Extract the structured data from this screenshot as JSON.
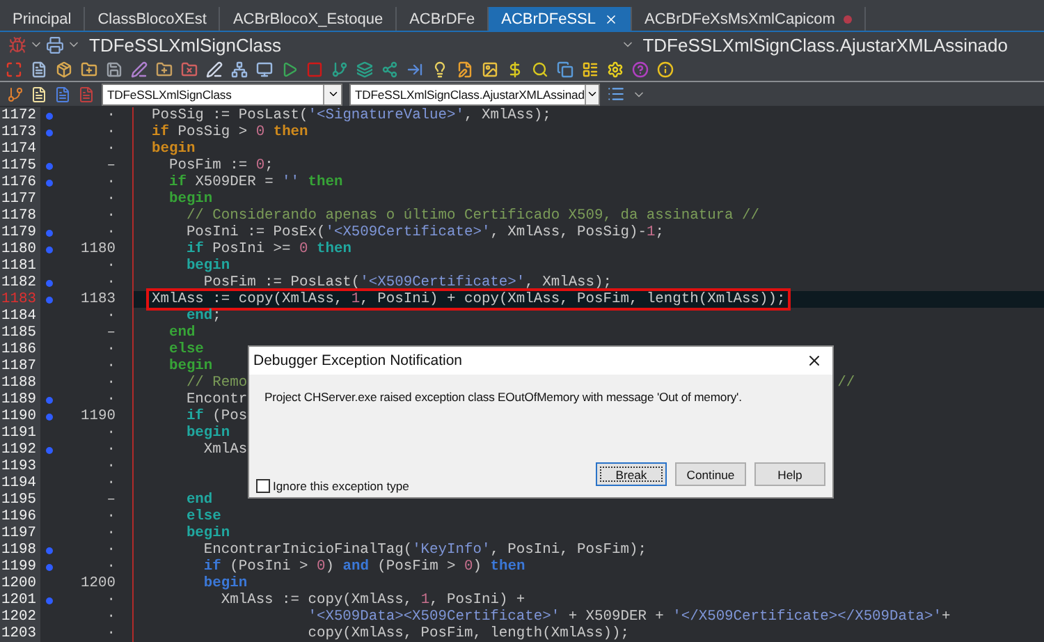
{
  "tabs": [
    {
      "label": "Principal",
      "selected": false,
      "modified": false,
      "closable": false
    },
    {
      "label": "ClassBlocoXEst",
      "selected": false,
      "modified": false,
      "closable": false
    },
    {
      "label": "ACBrBlocoX_Estoque",
      "selected": false,
      "modified": false,
      "closable": false
    },
    {
      "label": "ACBrDFe",
      "selected": false,
      "modified": false,
      "closable": false
    },
    {
      "label": "ACBrDFeSSL",
      "selected": true,
      "modified": false,
      "closable": true
    },
    {
      "label": "ACBrDFeXsMsXmlCapicom",
      "selected": false,
      "modified": true,
      "closable": false
    }
  ],
  "header": {
    "class_name": "TDFeSSLXmlSignClass",
    "method_name": "TDFeSSLXmlSignClass.AjustarXMLAssinado"
  },
  "navigator": {
    "class_combo": "TDFeSSLXmlSignClass",
    "method_combo": "TDFeSSLXmlSignClass.AjustarXMLAssinad"
  },
  "editor": {
    "lines": [
      {
        "number": "1172",
        "dot": true,
        "gutter": "·",
        "current": false,
        "boxed": false,
        "code": [
          {
            "kind": "text",
            "text": "PosSig := PosLast("
          },
          {
            "kind": "string",
            "text": "'<SignatureValue>'"
          },
          {
            "kind": "text",
            "text": ", XmlAss);"
          }
        ]
      },
      {
        "number": "1173",
        "dot": true,
        "gutter": "·",
        "current": false,
        "boxed": false,
        "code": [
          {
            "kind": "kw1",
            "text": "if"
          },
          {
            "kind": "text",
            "text": " PosSig > "
          },
          {
            "kind": "number",
            "text": "0"
          },
          {
            "kind": "kw1",
            "text": " then"
          }
        ]
      },
      {
        "number": "1174",
        "dot": false,
        "gutter": "·",
        "current": false,
        "boxed": false,
        "code": [
          {
            "kind": "kw1",
            "text": "begin"
          }
        ]
      },
      {
        "number": "1175",
        "dot": true,
        "gutter": "–",
        "current": false,
        "boxed": false,
        "code": [
          {
            "kind": "text",
            "text": "  PosFim := "
          },
          {
            "kind": "number",
            "text": "0"
          },
          {
            "kind": "text",
            "text": ";"
          }
        ]
      },
      {
        "number": "1176",
        "dot": true,
        "gutter": "·",
        "current": false,
        "boxed": false,
        "code": [
          {
            "kind": "kw2",
            "text": "  if"
          },
          {
            "kind": "text",
            "text": " X509DER = "
          },
          {
            "kind": "string",
            "text": "''"
          },
          {
            "kind": "kw2",
            "text": " then"
          }
        ]
      },
      {
        "number": "1177",
        "dot": false,
        "gutter": "·",
        "current": false,
        "boxed": false,
        "code": [
          {
            "kind": "kw2",
            "text": "  begin"
          }
        ]
      },
      {
        "number": "1178",
        "dot": false,
        "gutter": "·",
        "current": false,
        "boxed": false,
        "code": [
          {
            "kind": "comment",
            "text": "    // Considerando apenas o último Certificado X509, da assinatura //"
          }
        ]
      },
      {
        "number": "1179",
        "dot": true,
        "gutter": "·",
        "current": false,
        "boxed": false,
        "code": [
          {
            "kind": "text",
            "text": "    PosIni := PosEx("
          },
          {
            "kind": "string",
            "text": "'<X509Certificate>'"
          },
          {
            "kind": "text",
            "text": ", XmlAss, PosSig)-"
          },
          {
            "kind": "number",
            "text": "1"
          },
          {
            "kind": "text",
            "text": ";"
          }
        ]
      },
      {
        "number": "1180",
        "dot": true,
        "gutter": "1180",
        "current": false,
        "boxed": false,
        "code": [
          {
            "kind": "kw3",
            "text": "    if"
          },
          {
            "kind": "text",
            "text": " PosIni >= "
          },
          {
            "kind": "number",
            "text": "0"
          },
          {
            "kind": "kw3",
            "text": " then"
          }
        ]
      },
      {
        "number": "1181",
        "dot": false,
        "gutter": "·",
        "current": false,
        "boxed": false,
        "code": [
          {
            "kind": "kw3",
            "text": "    begin"
          }
        ]
      },
      {
        "number": "1182",
        "dot": true,
        "gutter": "·",
        "current": false,
        "boxed": false,
        "code": [
          {
            "kind": "text",
            "text": "      PosFim := PosLast("
          },
          {
            "kind": "string",
            "text": "'<X509Certificate>'"
          },
          {
            "kind": "text",
            "text": ", XmlAss);"
          }
        ]
      },
      {
        "number": "1183",
        "dot": true,
        "gutter": "1183",
        "current": true,
        "boxed": true,
        "code": [
          {
            "kind": "text",
            "text": "      XmlAss := copy(XmlAss, "
          },
          {
            "kind": "number",
            "text": "1"
          },
          {
            "kind": "text",
            "text": ", PosIni) + copy(XmlAss, PosFim, length(XmlAss));"
          }
        ]
      },
      {
        "number": "1184",
        "dot": false,
        "gutter": "·",
        "current": false,
        "boxed": false,
        "code": [
          {
            "kind": "kw3",
            "text": "    end"
          },
          {
            "kind": "text",
            "text": ";"
          }
        ]
      },
      {
        "number": "1185",
        "dot": false,
        "gutter": "–",
        "current": false,
        "boxed": false,
        "code": [
          {
            "kind": "kw2",
            "text": "  end"
          }
        ]
      },
      {
        "number": "1186",
        "dot": false,
        "gutter": "·",
        "current": false,
        "boxed": false,
        "code": [
          {
            "kind": "kw2",
            "text": "  else"
          }
        ]
      },
      {
        "number": "1187",
        "dot": false,
        "gutter": "·",
        "current": false,
        "boxed": false,
        "code": [
          {
            "kind": "kw2",
            "text": "  begin"
          }
        ]
      },
      {
        "number": "1188",
        "dot": false,
        "gutter": "·",
        "current": false,
        "boxed": false,
        "code": [
          {
            "kind": "comment",
            "text": "    // Remo"
          },
          {
            "kind": "comment",
            "text": "                                                                    //"
          }
        ]
      },
      {
        "number": "1189",
        "dot": true,
        "gutter": "·",
        "current": false,
        "boxed": false,
        "code": [
          {
            "kind": "text",
            "text": "    Encontr"
          }
        ]
      },
      {
        "number": "1190",
        "dot": true,
        "gutter": "1190",
        "current": false,
        "boxed": false,
        "code": [
          {
            "kind": "kw3",
            "text": "    if"
          },
          {
            "kind": "text",
            "text": " (Pos"
          }
        ]
      },
      {
        "number": "1191",
        "dot": false,
        "gutter": "·",
        "current": false,
        "boxed": false,
        "code": [
          {
            "kind": "kw3",
            "text": "    begin"
          }
        ]
      },
      {
        "number": "1192",
        "dot": true,
        "gutter": "·",
        "current": false,
        "boxed": false,
        "code": [
          {
            "kind": "text",
            "text": "      XmlAs"
          }
        ]
      },
      {
        "number": "1193",
        "dot": false,
        "gutter": "·",
        "current": false,
        "boxed": false
      },
      {
        "number": "1194",
        "dot": false,
        "gutter": "·",
        "current": false,
        "boxed": false
      },
      {
        "number": "1195",
        "dot": false,
        "gutter": "–",
        "current": false,
        "boxed": false,
        "code": [
          {
            "kind": "kw3",
            "text": "    end"
          }
        ]
      },
      {
        "number": "1196",
        "dot": false,
        "gutter": "·",
        "current": false,
        "boxed": false,
        "code": [
          {
            "kind": "kw3",
            "text": "    else"
          }
        ]
      },
      {
        "number": "1197",
        "dot": false,
        "gutter": "·",
        "current": false,
        "boxed": false,
        "code": [
          {
            "kind": "kw3",
            "text": "    begin"
          }
        ]
      },
      {
        "number": "1198",
        "dot": true,
        "gutter": "·",
        "current": false,
        "boxed": false,
        "code": [
          {
            "kind": "text",
            "text": "      EncontrarInicioFinalTag("
          },
          {
            "kind": "string",
            "text": "'KeyInfo'"
          },
          {
            "kind": "text",
            "text": ", PosIni, PosFim);"
          }
        ]
      },
      {
        "number": "1199",
        "dot": true,
        "gutter": "·",
        "current": false,
        "boxed": false,
        "code": [
          {
            "kind": "kw4",
            "text": "      if"
          },
          {
            "kind": "text",
            "text": " (PosIni > "
          },
          {
            "kind": "number",
            "text": "0"
          },
          {
            "kind": "text",
            "text": ") "
          },
          {
            "kind": "kw4",
            "text": "and"
          },
          {
            "kind": "text",
            "text": " (PosFim > "
          },
          {
            "kind": "number",
            "text": "0"
          },
          {
            "kind": "text",
            "text": ") "
          },
          {
            "kind": "kw4",
            "text": "then"
          }
        ]
      },
      {
        "number": "1200",
        "dot": false,
        "gutter": "1200",
        "current": false,
        "boxed": false,
        "code": [
          {
            "kind": "kw4",
            "text": "      begin"
          }
        ]
      },
      {
        "number": "1201",
        "dot": true,
        "gutter": "·",
        "current": false,
        "boxed": false,
        "code": [
          {
            "kind": "text",
            "text": "        XmlAss := copy(XmlAss, "
          },
          {
            "kind": "number",
            "text": "1"
          },
          {
            "kind": "text",
            "text": ", PosIni) +"
          }
        ]
      },
      {
        "number": "1202",
        "dot": false,
        "gutter": "·",
        "current": false,
        "boxed": false,
        "code": [
          {
            "kind": "string",
            "text": "                  '<X509Data><X509Certificate>'"
          },
          {
            "kind": "text",
            "text": " + X509DER + "
          },
          {
            "kind": "string",
            "text": "'</X509Certificate></X509Data>'"
          },
          {
            "kind": "text",
            "text": "+"
          }
        ]
      },
      {
        "number": "1203",
        "dot": false,
        "gutter": "·",
        "current": false,
        "boxed": false,
        "code": [
          {
            "kind": "text",
            "text": "                  copy(XmlAss, PosFim, length(XmlAss));"
          }
        ]
      }
    ]
  },
  "dialog": {
    "title": "Debugger Exception Notification",
    "message": "Project CHServer.exe raised exception class EOutOfMemory with message 'Out of memory'.",
    "checkbox": {
      "label": "Ignore this exception type",
      "checked": false
    },
    "buttons": [
      {
        "label": "Break",
        "default": true
      },
      {
        "label": "Continue",
        "default": false
      },
      {
        "label": "Help",
        "default": false
      }
    ]
  }
}
